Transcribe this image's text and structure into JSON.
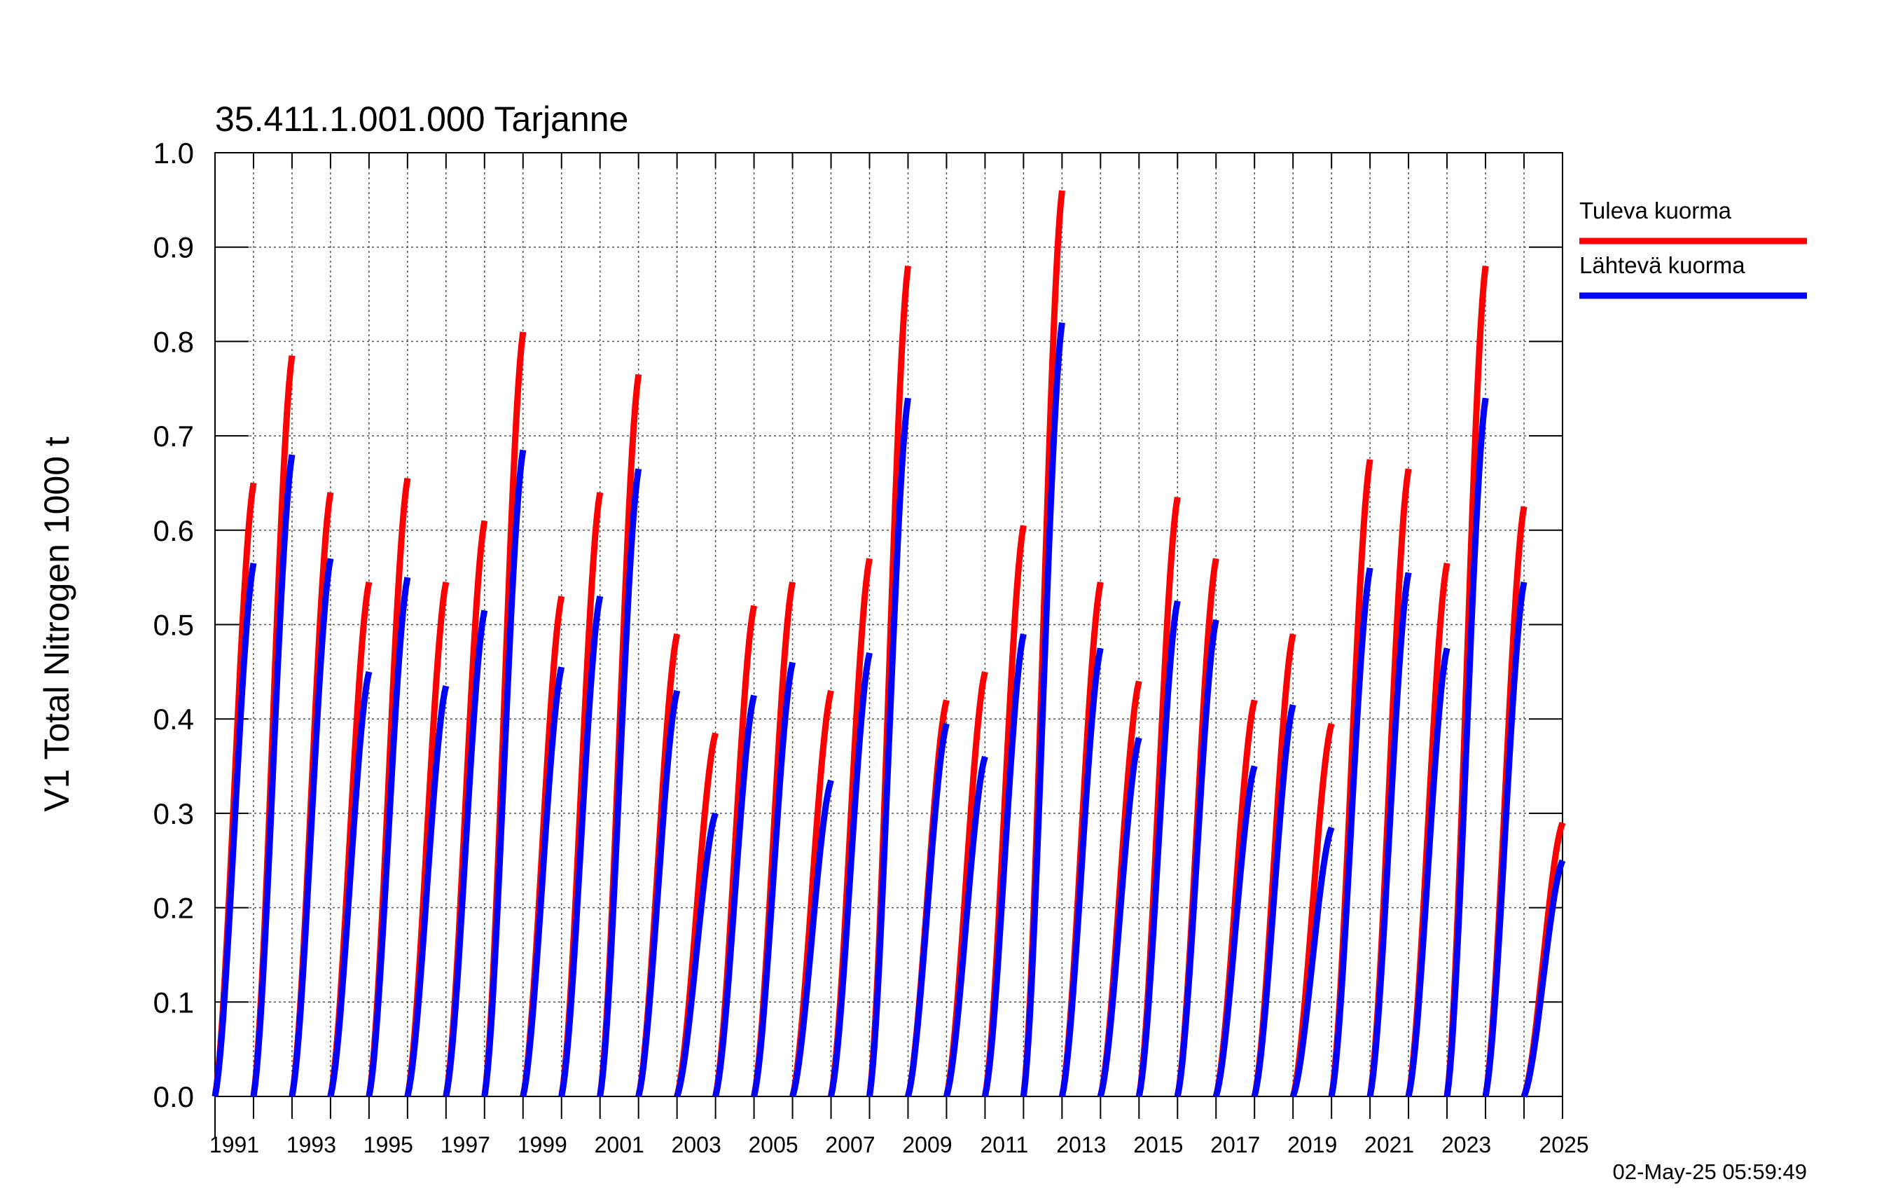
{
  "chart_data": {
    "type": "line",
    "title": "35.411.1.001.000 Tarjanne",
    "ylabel": "V1 Total Nitrogen 1000 t",
    "xlabel": "",
    "ylim": [
      0,
      1.0
    ],
    "xlim": [
      1990,
      2025
    ],
    "grid": true,
    "legend_position": "right",
    "y_ticks": [
      "0.0",
      "0.1",
      "0.2",
      "0.3",
      "0.4",
      "0.5",
      "0.6",
      "0.7",
      "0.8",
      "0.9",
      "1.0"
    ],
    "x_tick_labels": [
      "1991",
      "1993",
      "1995",
      "1997",
      "1999",
      "2001",
      "2003",
      "2005",
      "2007",
      "2009",
      "2011",
      "2013",
      "2015",
      "2017",
      "2019",
      "2021",
      "2023",
      "2025"
    ],
    "timestamp": "02-May-25 05:59:49",
    "series": [
      {
        "name": "Tuleva kuorma",
        "color": "#ff0000",
        "annual_totals": [
          0.65,
          0.785,
          0.64,
          0.545,
          0.655,
          0.545,
          0.61,
          0.81,
          0.53,
          0.64,
          0.765,
          0.49,
          0.385,
          0.52,
          0.545,
          0.43,
          0.57,
          0.88,
          0.42,
          0.45,
          0.605,
          0.96,
          0.545,
          0.44,
          0.635,
          0.57,
          0.42,
          0.49,
          0.395,
          0.675,
          0.665,
          0.565,
          0.88,
          0.625,
          0.29
        ]
      },
      {
        "name": "Lähtevä kuorma",
        "color": "#0000ff",
        "annual_totals": [
          0.565,
          0.68,
          0.57,
          0.45,
          0.55,
          0.435,
          0.515,
          0.685,
          0.455,
          0.53,
          0.665,
          0.43,
          0.3,
          0.425,
          0.46,
          0.335,
          0.47,
          0.74,
          0.395,
          0.36,
          0.49,
          0.82,
          0.475,
          0.38,
          0.525,
          0.505,
          0.35,
          0.415,
          0.285,
          0.56,
          0.555,
          0.475,
          0.74,
          0.545,
          0.25
        ]
      }
    ]
  }
}
